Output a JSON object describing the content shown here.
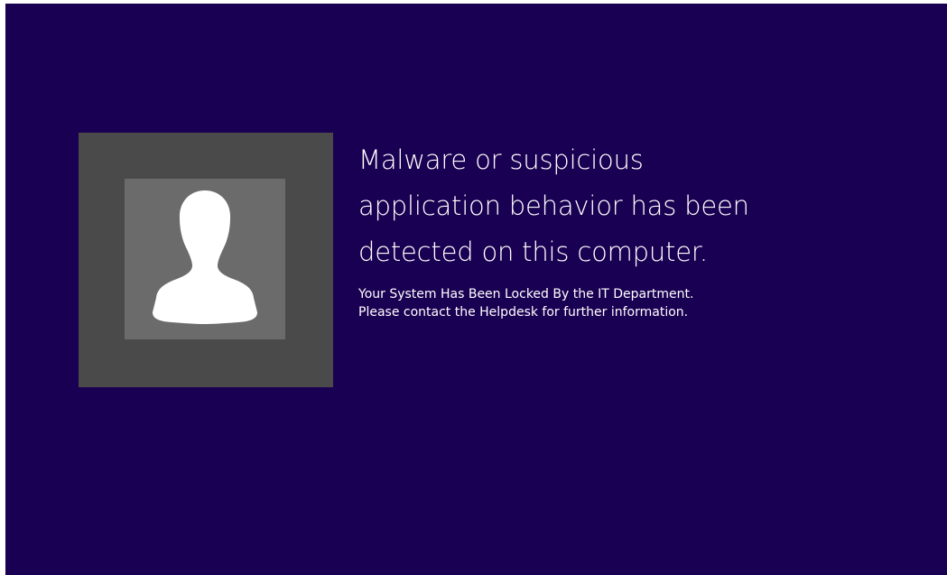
{
  "lock_screen": {
    "headline": [
      "Malware or suspicious",
      "application behavior has been",
      "detected on this computer."
    ],
    "details": [
      "Your System Has Been Locked By the IT Department.",
      "Please contact the Helpdesk for further information."
    ],
    "avatar_icon": "user-silhouette-icon",
    "colors": {
      "background": "#1a0052",
      "tile_outer": "#4a4a4a",
      "tile_inner": "#6b6b6b",
      "text": "#ffffff"
    }
  }
}
